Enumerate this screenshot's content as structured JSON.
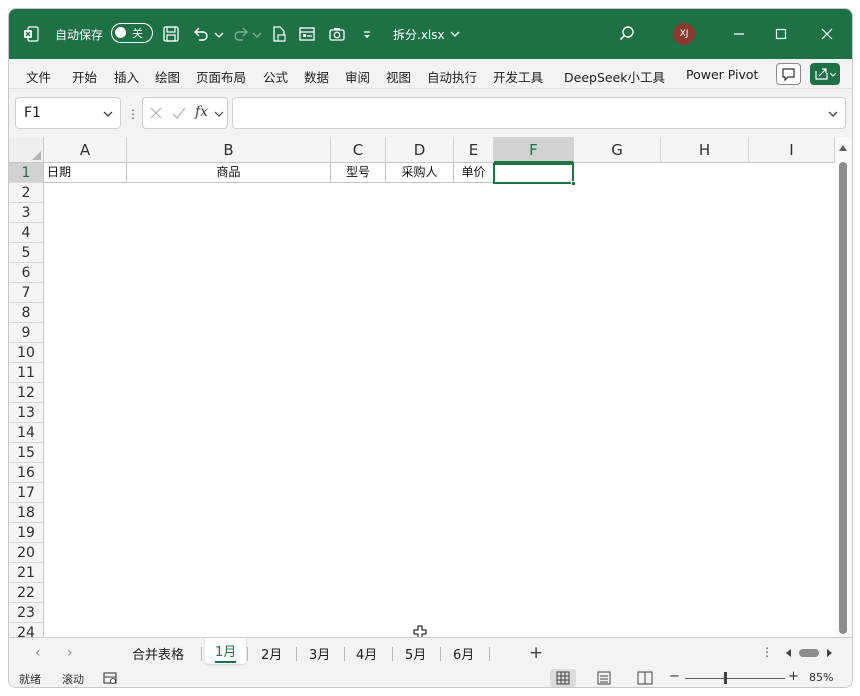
{
  "titlebar": {
    "autosave_label": "自动保存",
    "autosave_state": "关",
    "filename": "拆分.xlsx",
    "avatar_initials": "XJ",
    "bg_color": "#1e7145"
  },
  "menu": {
    "items": [
      "文件",
      "开始",
      "插入",
      "绘图",
      "页面布局",
      "公式",
      "数据",
      "审阅",
      "视图",
      "自动执行",
      "开发工具",
      "DeepSeek小工具",
      "Power Pivot"
    ]
  },
  "formula": {
    "name_box": "F1",
    "fx": "fx",
    "content": ""
  },
  "grid": {
    "columns": [
      "A",
      "B",
      "C",
      "D",
      "E",
      "F",
      "G",
      "H",
      "I"
    ],
    "selected_column": "F",
    "rows": [
      "1",
      "2",
      "3",
      "4",
      "5",
      "6",
      "7",
      "8",
      "9",
      "10",
      "11",
      "12",
      "13",
      "14",
      "15",
      "16",
      "17",
      "18",
      "19",
      "20",
      "21",
      "22",
      "23",
      "24"
    ],
    "header_cells": {
      "A1": "日期",
      "B1": "商品",
      "C1": "型号",
      "D1": "采购人",
      "E1": "单价"
    }
  },
  "sheets": {
    "tabs": [
      "合并表格",
      "1月",
      "2月",
      "3月",
      "4月",
      "5月",
      "6月"
    ],
    "active": "1月",
    "add_label": "+"
  },
  "status": {
    "ready": "就绪",
    "scroll": "滚动",
    "zoom": "85%",
    "zoom_fraction": 0.4
  }
}
